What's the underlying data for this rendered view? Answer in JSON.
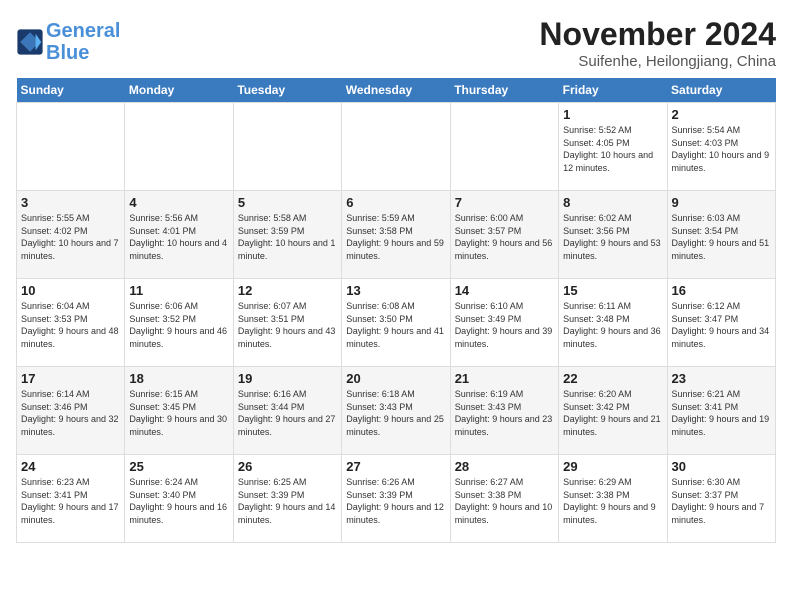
{
  "header": {
    "logo_line1": "General",
    "logo_line2": "Blue",
    "month_year": "November 2024",
    "location": "Suifenhe, Heilongjiang, China"
  },
  "weekdays": [
    "Sunday",
    "Monday",
    "Tuesday",
    "Wednesday",
    "Thursday",
    "Friday",
    "Saturday"
  ],
  "weeks": [
    [
      {
        "day": "",
        "detail": ""
      },
      {
        "day": "",
        "detail": ""
      },
      {
        "day": "",
        "detail": ""
      },
      {
        "day": "",
        "detail": ""
      },
      {
        "day": "",
        "detail": ""
      },
      {
        "day": "1",
        "detail": "Sunrise: 5:52 AM\nSunset: 4:05 PM\nDaylight: 10 hours and 12 minutes."
      },
      {
        "day": "2",
        "detail": "Sunrise: 5:54 AM\nSunset: 4:03 PM\nDaylight: 10 hours and 9 minutes."
      }
    ],
    [
      {
        "day": "3",
        "detail": "Sunrise: 5:55 AM\nSunset: 4:02 PM\nDaylight: 10 hours and 7 minutes."
      },
      {
        "day": "4",
        "detail": "Sunrise: 5:56 AM\nSunset: 4:01 PM\nDaylight: 10 hours and 4 minutes."
      },
      {
        "day": "5",
        "detail": "Sunrise: 5:58 AM\nSunset: 3:59 PM\nDaylight: 10 hours and 1 minute."
      },
      {
        "day": "6",
        "detail": "Sunrise: 5:59 AM\nSunset: 3:58 PM\nDaylight: 9 hours and 59 minutes."
      },
      {
        "day": "7",
        "detail": "Sunrise: 6:00 AM\nSunset: 3:57 PM\nDaylight: 9 hours and 56 minutes."
      },
      {
        "day": "8",
        "detail": "Sunrise: 6:02 AM\nSunset: 3:56 PM\nDaylight: 9 hours and 53 minutes."
      },
      {
        "day": "9",
        "detail": "Sunrise: 6:03 AM\nSunset: 3:54 PM\nDaylight: 9 hours and 51 minutes."
      }
    ],
    [
      {
        "day": "10",
        "detail": "Sunrise: 6:04 AM\nSunset: 3:53 PM\nDaylight: 9 hours and 48 minutes."
      },
      {
        "day": "11",
        "detail": "Sunrise: 6:06 AM\nSunset: 3:52 PM\nDaylight: 9 hours and 46 minutes."
      },
      {
        "day": "12",
        "detail": "Sunrise: 6:07 AM\nSunset: 3:51 PM\nDaylight: 9 hours and 43 minutes."
      },
      {
        "day": "13",
        "detail": "Sunrise: 6:08 AM\nSunset: 3:50 PM\nDaylight: 9 hours and 41 minutes."
      },
      {
        "day": "14",
        "detail": "Sunrise: 6:10 AM\nSunset: 3:49 PM\nDaylight: 9 hours and 39 minutes."
      },
      {
        "day": "15",
        "detail": "Sunrise: 6:11 AM\nSunset: 3:48 PM\nDaylight: 9 hours and 36 minutes."
      },
      {
        "day": "16",
        "detail": "Sunrise: 6:12 AM\nSunset: 3:47 PM\nDaylight: 9 hours and 34 minutes."
      }
    ],
    [
      {
        "day": "17",
        "detail": "Sunrise: 6:14 AM\nSunset: 3:46 PM\nDaylight: 9 hours and 32 minutes."
      },
      {
        "day": "18",
        "detail": "Sunrise: 6:15 AM\nSunset: 3:45 PM\nDaylight: 9 hours and 30 minutes."
      },
      {
        "day": "19",
        "detail": "Sunrise: 6:16 AM\nSunset: 3:44 PM\nDaylight: 9 hours and 27 minutes."
      },
      {
        "day": "20",
        "detail": "Sunrise: 6:18 AM\nSunset: 3:43 PM\nDaylight: 9 hours and 25 minutes."
      },
      {
        "day": "21",
        "detail": "Sunrise: 6:19 AM\nSunset: 3:43 PM\nDaylight: 9 hours and 23 minutes."
      },
      {
        "day": "22",
        "detail": "Sunrise: 6:20 AM\nSunset: 3:42 PM\nDaylight: 9 hours and 21 minutes."
      },
      {
        "day": "23",
        "detail": "Sunrise: 6:21 AM\nSunset: 3:41 PM\nDaylight: 9 hours and 19 minutes."
      }
    ],
    [
      {
        "day": "24",
        "detail": "Sunrise: 6:23 AM\nSunset: 3:41 PM\nDaylight: 9 hours and 17 minutes."
      },
      {
        "day": "25",
        "detail": "Sunrise: 6:24 AM\nSunset: 3:40 PM\nDaylight: 9 hours and 16 minutes."
      },
      {
        "day": "26",
        "detail": "Sunrise: 6:25 AM\nSunset: 3:39 PM\nDaylight: 9 hours and 14 minutes."
      },
      {
        "day": "27",
        "detail": "Sunrise: 6:26 AM\nSunset: 3:39 PM\nDaylight: 9 hours and 12 minutes."
      },
      {
        "day": "28",
        "detail": "Sunrise: 6:27 AM\nSunset: 3:38 PM\nDaylight: 9 hours and 10 minutes."
      },
      {
        "day": "29",
        "detail": "Sunrise: 6:29 AM\nSunset: 3:38 PM\nDaylight: 9 hours and 9 minutes."
      },
      {
        "day": "30",
        "detail": "Sunrise: 6:30 AM\nSunset: 3:37 PM\nDaylight: 9 hours and 7 minutes."
      }
    ]
  ]
}
